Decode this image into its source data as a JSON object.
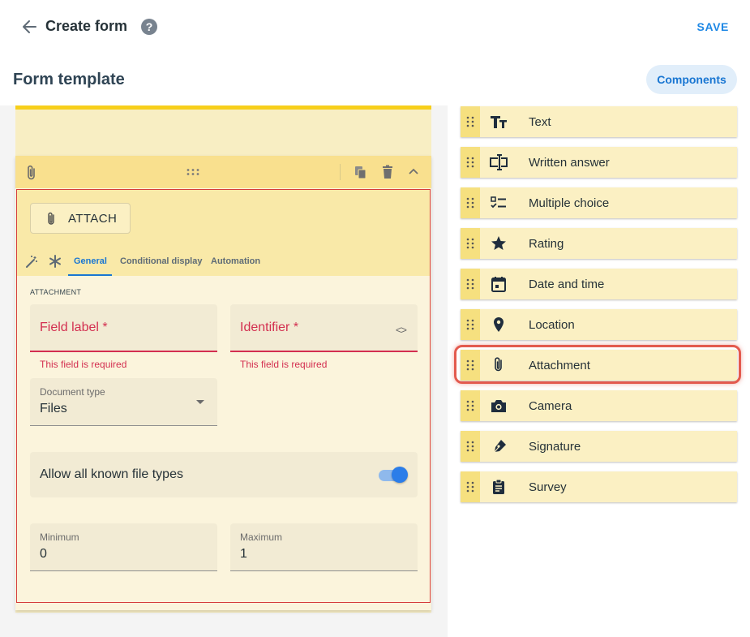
{
  "header": {
    "title": "Create form",
    "help_glyph": "?",
    "save_label": "SAVE"
  },
  "template": {
    "title": "Form template",
    "components_label": "Components"
  },
  "card": {
    "attach_label": "ATTACH",
    "tabs": [
      {
        "label": "General",
        "active": true
      },
      {
        "label": "Conditional display",
        "active": false
      },
      {
        "label": "Automation",
        "active": false
      }
    ],
    "section_label": "ATTACHMENT",
    "field_label": {
      "label": "Field label *",
      "helper": "This field is required"
    },
    "identifier": {
      "label": "Identifier *",
      "helper": "This field is required",
      "icon": "<>"
    },
    "document_type": {
      "label": "Document type",
      "value": "Files"
    },
    "allow_types": {
      "label": "Allow all known file types",
      "enabled": true
    },
    "minimum": {
      "label": "Minimum",
      "value": "0"
    },
    "maximum": {
      "label": "Maximum",
      "value": "1"
    }
  },
  "components": [
    {
      "label": "Text",
      "icon": "text-format-icon"
    },
    {
      "label": "Written answer",
      "icon": "text-input-icon"
    },
    {
      "label": "Multiple choice",
      "icon": "checklist-icon"
    },
    {
      "label": "Rating",
      "icon": "star-icon"
    },
    {
      "label": "Date and time",
      "icon": "calendar-icon"
    },
    {
      "label": "Location",
      "icon": "location-pin-icon"
    },
    {
      "label": "Attachment",
      "icon": "paperclip-icon",
      "highlighted": true
    },
    {
      "label": "Camera",
      "icon": "camera-icon"
    },
    {
      "label": "Signature",
      "icon": "pen-icon"
    },
    {
      "label": "Survey",
      "icon": "clipboard-icon"
    }
  ],
  "colors": {
    "accent": "#1976d2",
    "error": "#d32f50",
    "card_header": "#f9e08e",
    "highlight": "#e35a4e"
  }
}
